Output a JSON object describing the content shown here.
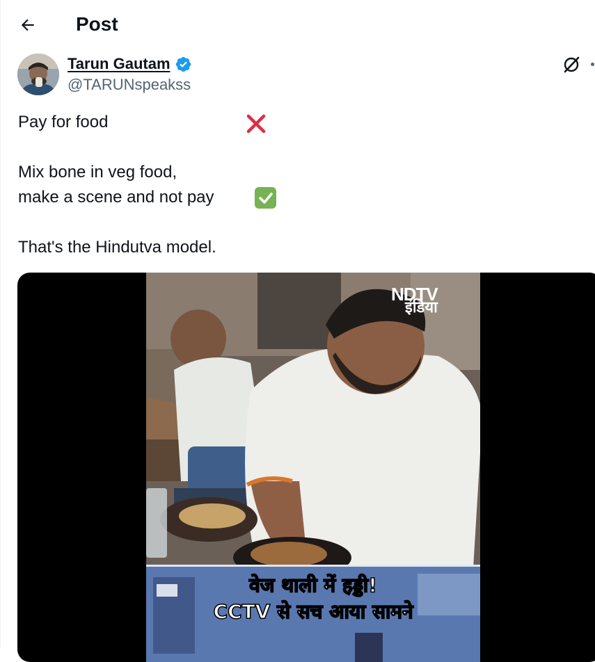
{
  "header": {
    "title": "Post"
  },
  "author": {
    "name": "Tarun Gautam",
    "handle": "@TARUNspeakss",
    "verified": true,
    "verified_color": "#1d9bf0"
  },
  "tweet": {
    "lines": [
      "Pay for food",
      "Mix bone in veg food,",
      "make a scene and not pay",
      "That's the Hindutva model."
    ],
    "emoji_1": "cross-mark-icon",
    "emoji_2": "check-mark-button-icon"
  },
  "media": {
    "watermark_main": "NDTV",
    "watermark_sub": "इंडिया",
    "caption_line1": "वेज थाली में हड्डी!",
    "caption_line2": "CCTV से सच आया सामने"
  },
  "colors": {
    "accent": "#1d9bf0",
    "cross": "#dd2e44",
    "check_bg": "#77b255",
    "secondary_text": "#536471"
  }
}
